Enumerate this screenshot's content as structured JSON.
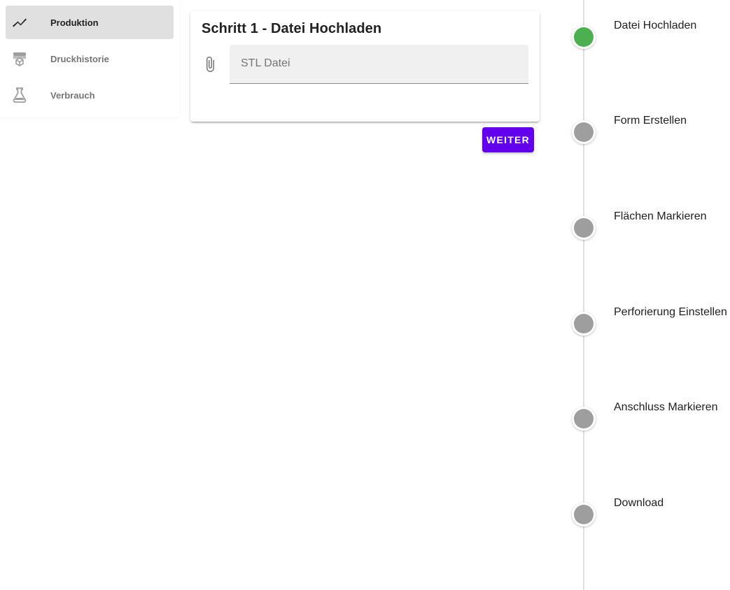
{
  "sidebar": {
    "items": [
      {
        "label": "Produktion",
        "icon": "trending-line-icon",
        "active": true
      },
      {
        "label": "Druckhistorie",
        "icon": "printer-icon",
        "active": false
      },
      {
        "label": "Verbrauch",
        "icon": "flask-icon",
        "active": false
      }
    ]
  },
  "upload_card": {
    "title": "Schritt 1 - Datei Hochladen",
    "file_placeholder": "STL Datei",
    "icon": "paperclip-icon"
  },
  "next_button": {
    "label": "Weiter"
  },
  "timeline": {
    "steps": [
      {
        "label": "Datei Hochladen",
        "status": "active",
        "color": "#4caf50"
      },
      {
        "label": "Form Erstellen",
        "status": "pending",
        "color": "#9e9e9e"
      },
      {
        "label": "Flächen Markieren",
        "status": "pending",
        "color": "#9e9e9e"
      },
      {
        "label": "Perforierung Einstellen",
        "status": "pending",
        "color": "#9e9e9e"
      },
      {
        "label": "Anschluss Markieren",
        "status": "pending",
        "color": "#9e9e9e"
      },
      {
        "label": "Download",
        "status": "pending",
        "color": "#9e9e9e"
      }
    ]
  },
  "colors": {
    "accent": "#6200ee",
    "step_done": "#4caf50",
    "step_pending": "#9e9e9e"
  }
}
